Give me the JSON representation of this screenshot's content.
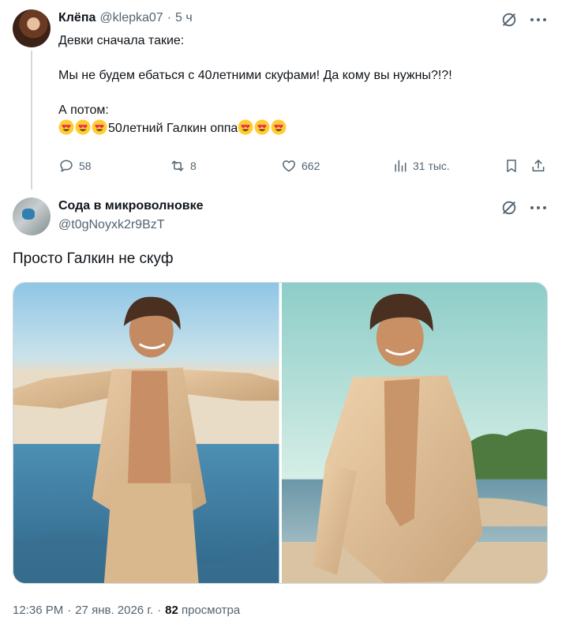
{
  "reply_tweet": {
    "author_name": "Клёпа",
    "author_handle": "@klepka07",
    "separator": "·",
    "time": "5 ч",
    "text_lines": [
      "Девки сначала такие:",
      "Мы не будем ебаться с 40летними скуфами! Да кому вы нужны?!?!",
      "А потом:"
    ],
    "emoji_line_text": "50летний Галкин оппа",
    "emoji_name": "smiling-face-with-heart-eyes",
    "stats": {
      "replies": "58",
      "retweets": "8",
      "likes": "662",
      "views": "31 тыс."
    }
  },
  "main_tweet": {
    "author_name": "Сода в микроволновке",
    "author_handle": "@t0gNoyxk2r9BzT",
    "text": "Просто Галкин не скуф",
    "photos": [
      {
        "name": "photo-arms-open"
      },
      {
        "name": "photo-hand-in-pocket"
      }
    ],
    "meta": {
      "time": "12:36 PM",
      "separator": "·",
      "date": "27 янв. 2026 г.",
      "views_count": "82",
      "views_label": "просмотра"
    }
  },
  "colors": {
    "text_primary": "#0f1419",
    "text_secondary": "#536471",
    "border": "#cfd9de",
    "background": "#ffffff"
  }
}
